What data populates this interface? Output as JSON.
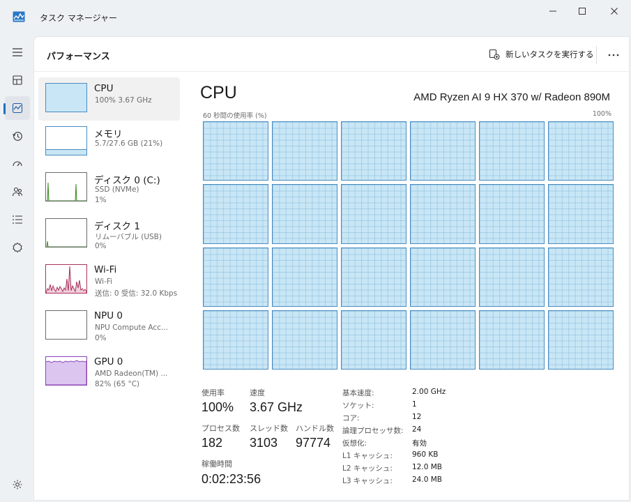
{
  "window": {
    "title": "タスク マネージャー"
  },
  "nav": {
    "items": [
      {
        "name": "menu-icon"
      },
      {
        "name": "processes-icon"
      },
      {
        "name": "performance-icon"
      },
      {
        "name": "app-history-icon"
      },
      {
        "name": "startup-icon"
      },
      {
        "name": "users-icon"
      },
      {
        "name": "details-icon"
      },
      {
        "name": "services-icon"
      },
      {
        "name": "settings-icon"
      }
    ],
    "active": "performance-icon"
  },
  "header": {
    "title": "パフォーマンス",
    "run_task_label": "新しいタスクを実行する",
    "more_label": "..."
  },
  "resources": [
    {
      "name": "CPU",
      "sub1": "100%  3.67 GHz",
      "sub2": "",
      "color": "#4a8bbf"
    },
    {
      "name": "メモリ",
      "sub1": "5.7/27.6 GB (21%)",
      "sub2": "",
      "color": "#4a8bbf"
    },
    {
      "name": "ディスク 0 (C:)",
      "sub1": "SSD (NVMe)",
      "sub2": "1%",
      "color": "#3c8a27"
    },
    {
      "name": "ディスク 1",
      "sub1": "リムーバブル (USB)",
      "sub2": "0%",
      "color": "#3c8a27"
    },
    {
      "name": "Wi-Fi",
      "sub1": "Wi-Fi",
      "sub2": "送信: 0  受信: 32.0 Kbps",
      "color": "#a8315b"
    },
    {
      "name": "NPU 0",
      "sub1": "NPU Compute Acc...",
      "sub2": "0%",
      "color": "#4a8bbf"
    },
    {
      "name": "GPU 0",
      "sub1": "AMD Radeon(TM) ...",
      "sub2": "82%  (65 °C)",
      "color": "#8a44b8"
    }
  ],
  "cpu": {
    "title": "CPU",
    "model": "AMD Ryzen AI 9 HX 370 w/ Radeon 890M",
    "graph_label": "60 秒間の使用率 (%)",
    "graph_max": "100%",
    "logical_processors": 24,
    "utilization_label": "使用率",
    "utilization": "100%",
    "speed_label": "速度",
    "speed": "3.67 GHz",
    "processes_label": "プロセス数",
    "processes": "182",
    "threads_label": "スレッド数",
    "threads": "3103",
    "handles_label": "ハンドル数",
    "handles": "97774",
    "uptime_label": "稼働時間",
    "uptime": "0:02:23:56",
    "specs": [
      {
        "k": "基本速度:",
        "v": "2.00 GHz"
      },
      {
        "k": "ソケット:",
        "v": "1"
      },
      {
        "k": "コア:",
        "v": "12"
      },
      {
        "k": "論理プロセッサ数:",
        "v": "24"
      },
      {
        "k": "仮想化:",
        "v": "有効"
      },
      {
        "k": "L1 キャッシュ:",
        "v": "960 KB"
      },
      {
        "k": "L2 キャッシュ:",
        "v": "12.0 MB"
      },
      {
        "k": "L3 キャッシュ:",
        "v": "24.0 MB"
      }
    ]
  }
}
